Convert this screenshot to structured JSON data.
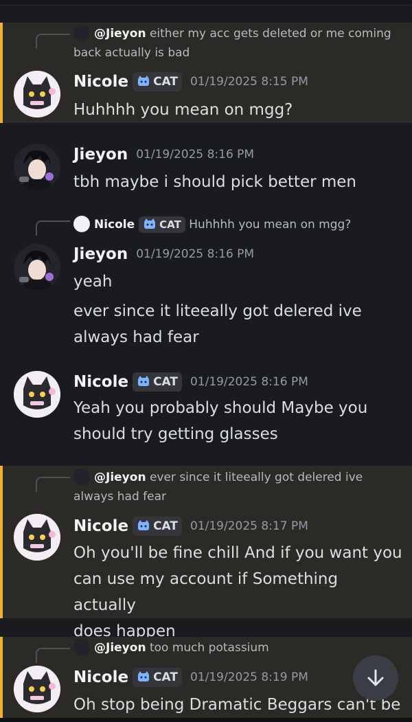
{
  "messages": [
    {
      "reply": {
        "name": "@Jieyon",
        "line1": " either my acc gets deleted or me coming",
        "line2": "back actually is bad"
      },
      "author": "Nicole",
      "tag": "CAT",
      "time": "01/19/2025 8:15 PM",
      "lines": [
        "Huhhhh you mean on mgg?"
      ]
    },
    {
      "author": "Jieyon",
      "time": "01/19/2025 8:16 PM",
      "lines": [
        "tbh maybe i should pick better men"
      ]
    },
    {
      "reply": {
        "name": "Nicole",
        "tag": "CAT",
        "text": "Huhhhh you mean on mgg?"
      },
      "author": "Jieyon",
      "time": "01/19/2025 8:16 PM",
      "lines": [
        "yeah",
        "ever since it liteeally got delered ive",
        "always had fear"
      ]
    },
    {
      "author": "Nicole",
      "tag": "CAT",
      "time": "01/19/2025 8:16 PM",
      "lines": [
        "Yeah you probably should Maybe you",
        "should try getting glasses"
      ]
    },
    {
      "reply": {
        "name": "@Jieyon",
        "line1": " ever since it liteeally got delered ive",
        "line2": "always had fear"
      },
      "author": "Nicole",
      "tag": "CAT",
      "time": "01/19/2025 8:17 PM",
      "lines": [
        "Oh you'll be fine chill And if you want you",
        "can use my account if Something actually",
        "does happen"
      ]
    },
    {
      "reply": {
        "name": "@Jieyon",
        "line1": " too much potassium"
      },
      "author": "Nicole",
      "tag": "CAT",
      "time": "01/19/2025 8:19 PM",
      "lines": [
        "Oh stop being Dramatic Beggars can't be"
      ]
    }
  ],
  "colors": {
    "background": "#1a1b1f",
    "highlight": "#2c2a27",
    "mention_bar": "#f0b232",
    "timestamp": "#949ba4"
  },
  "icons": {
    "scroll": "arrow-down-icon",
    "tag": "cat-icon"
  }
}
